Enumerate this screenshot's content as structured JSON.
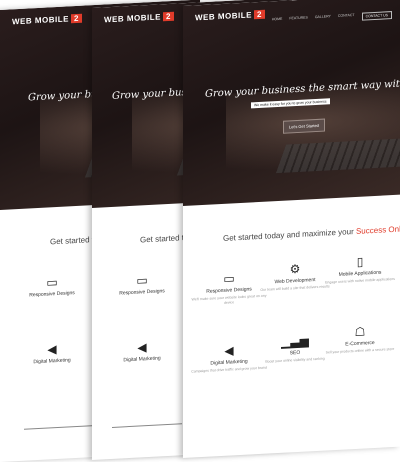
{
  "brand": {
    "name": "WEB MOBILE",
    "badge": "2"
  },
  "nav": [
    "HOME",
    "FEATURES",
    "GALLERY",
    "CONTACT"
  ],
  "nav_cta": "CONTACT US",
  "hero": {
    "headline": "Grow your business the smart way with digital World",
    "subline": "We make it easy for you to grow your business",
    "button": "Let's Get Started"
  },
  "section_title_prefix": "Get started today and maximize your ",
  "section_title_accent": "Success Online",
  "section_title_short": "Get started toda",
  "features": [
    {
      "icon": "laptop-icon",
      "glyph": "▭",
      "title": "Responsive Designs",
      "text": "We'll make sure your website looks great on any device"
    },
    {
      "icon": "code-icon",
      "glyph": "⚙",
      "title": "Web Development",
      "text": "Our team will build a site that delivers results"
    },
    {
      "icon": "mobile-icon",
      "glyph": "▯",
      "title": "Mobile Applications",
      "text": "Engage users with native mobile applications"
    },
    {
      "icon": "megaphone-icon",
      "glyph": "◀",
      "title": "Digital Marketing",
      "text": "Campaigns that drive traffic and grow your brand"
    },
    {
      "icon": "chart-icon",
      "glyph": "▁▃▅",
      "title": "SEO",
      "text": "Boost your online visibility and ranking"
    },
    {
      "icon": "cart-icon",
      "glyph": "☖",
      "title": "E-Commerce",
      "text": "Sell your products online with a secure store"
    }
  ],
  "accent_color": "#e03b2a"
}
